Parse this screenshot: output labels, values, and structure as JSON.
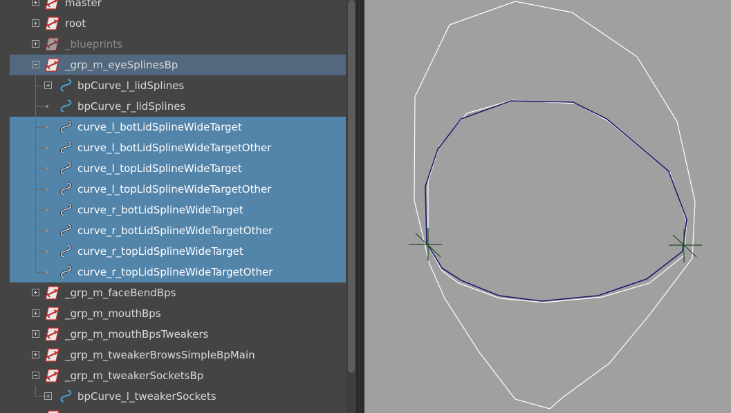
{
  "outliner": {
    "rows": [
      {
        "label": "master",
        "type": "transform",
        "expander": "plus",
        "indent": 0,
        "state": "normal"
      },
      {
        "label": "root",
        "type": "transform",
        "expander": "plus",
        "indent": 0,
        "state": "normal"
      },
      {
        "label": "_blueprints",
        "type": "transform",
        "expander": "plus",
        "indent": 0,
        "state": "dim"
      },
      {
        "label": "_grp_m_eyeSplinesBp",
        "type": "transform",
        "expander": "minus",
        "indent": 0,
        "state": "highlight"
      },
      {
        "label": "bpCurve_l_lidSplines",
        "type": "curve",
        "expander": "plus",
        "indent": 1,
        "state": "normal"
      },
      {
        "label": "bpCurve_r_lidSplines",
        "type": "curve",
        "expander": "none",
        "indent": 1,
        "state": "normal"
      },
      {
        "label": "curve_l_botLidSplineWideTarget",
        "type": "curve-double",
        "expander": "none",
        "indent": 1,
        "state": "selected"
      },
      {
        "label": "curve_l_botLidSplineWideTargetOther",
        "type": "curve-double",
        "expander": "none",
        "indent": 1,
        "state": "selected"
      },
      {
        "label": "curve_l_topLidSplineWideTarget",
        "type": "curve-double",
        "expander": "none",
        "indent": 1,
        "state": "selected"
      },
      {
        "label": "curve_l_topLidSplineWideTargetOther",
        "type": "curve-double",
        "expander": "none",
        "indent": 1,
        "state": "selected"
      },
      {
        "label": "curve_r_botLidSplineWideTarget",
        "type": "curve-double",
        "expander": "none",
        "indent": 1,
        "state": "selected"
      },
      {
        "label": "curve_r_botLidSplineWideTargetOther",
        "type": "curve-double",
        "expander": "none",
        "indent": 1,
        "state": "selected"
      },
      {
        "label": "curve_r_topLidSplineWideTarget",
        "type": "curve-double",
        "expander": "none",
        "indent": 1,
        "state": "selected"
      },
      {
        "label": "curve_r_topLidSplineWideTargetOther",
        "type": "curve-double",
        "expander": "none",
        "indent": 1,
        "state": "selected"
      },
      {
        "label": "_grp_m_faceBendBps",
        "type": "transform",
        "expander": "plus",
        "indent": 0,
        "state": "normal"
      },
      {
        "label": "_grp_m_mouthBps",
        "type": "transform",
        "expander": "plus",
        "indent": 0,
        "state": "normal"
      },
      {
        "label": "_grp_m_mouthBpsTweakers",
        "type": "transform",
        "expander": "plus",
        "indent": 0,
        "state": "normal"
      },
      {
        "label": "_grp_m_tweakerBrowsSimpleBpMain",
        "type": "transform",
        "expander": "plus",
        "indent": 0,
        "state": "normal"
      },
      {
        "label": "_grp_m_tweakerSocketsBp",
        "type": "transform",
        "expander": "minus",
        "indent": 0,
        "state": "normal"
      },
      {
        "label": "bpCurve_l_tweakerSockets",
        "type": "curve",
        "expander": "plus",
        "indent": 1,
        "state": "normal"
      },
      {
        "label": "",
        "type": "transform",
        "expander": "plus",
        "indent": 0,
        "state": "normal"
      }
    ]
  },
  "viewport": {
    "background": "#a0a0a0",
    "curve_white": "#ffffff",
    "curve_selected": "#1a1a6e",
    "locator_color": "#1e4a1e"
  },
  "colors": {
    "outliner_bg": "#444444",
    "highlight_row": "#51687e",
    "selected_rows": "#5384aa",
    "transform_icon_red": "#c8302c",
    "curve_icon_blue": "#4aa3d8"
  }
}
